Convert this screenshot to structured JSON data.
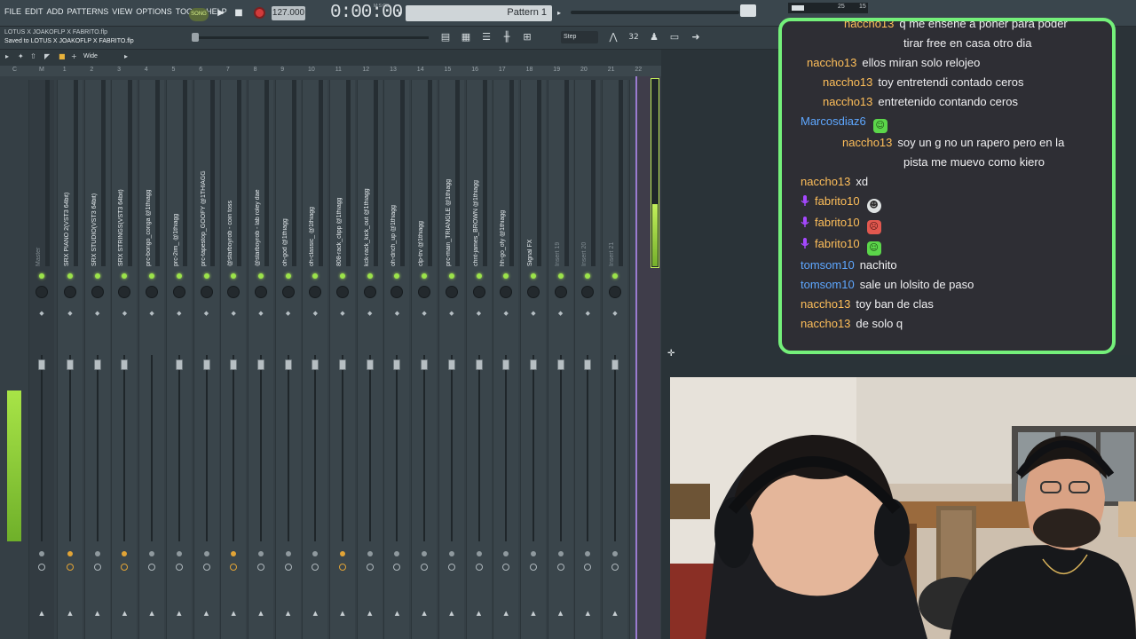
{
  "menubar": {
    "items": [
      "FILE",
      "EDIT",
      "ADD",
      "PATTERNS",
      "VIEW",
      "OPTIONS",
      "TOOLS",
      "HELP"
    ],
    "song_toggle": "SONG",
    "tempo": "127.000",
    "time": "0:00:00",
    "time_unit": "M:S:CS",
    "pattern": "Pattern 1",
    "meter_values": [
      "25",
      "15"
    ]
  },
  "hintbar": {
    "file_line": "LOTUS X JOAKOFLP X FABRITO.flp",
    "status_line": "Saved to LOTUS X JOAKOFLP X FABRITO.flp",
    "snap": "Step"
  },
  "mixer": {
    "view_mode": "Wide",
    "ruler": [
      "C",
      "M",
      "1",
      "2",
      "3",
      "4",
      "5",
      "6",
      "7",
      "8",
      "9",
      "10",
      "11",
      "12",
      "13",
      "14",
      "15",
      "16",
      "17",
      "18",
      "19",
      "20",
      "21",
      "22"
    ],
    "tracks": [
      {
        "name": "Master",
        "dim": true
      },
      {
        "name": "SRX PIANO 2(VST3 64bit)",
        "dim": false
      },
      {
        "name": "SRX STUDIO(VST3 64bit)",
        "dim": false
      },
      {
        "name": "SRX STRINGS(VST3 64bit)",
        "dim": false
      },
      {
        "name": "prc-bongo_conga @1thiagg",
        "dim": false
      },
      {
        "name": "prc-2im_ @1thiagg",
        "dim": false
      },
      {
        "name": "prc-tapestop_GOOFY @1THIAGG",
        "dim": false
      },
      {
        "name": "@starboyrob - coin toss",
        "dim": false
      },
      {
        "name": "@starboyrob - lab roley dae",
        "dim": false
      },
      {
        "name": "oh-god @1thiagg",
        "dim": false
      },
      {
        "name": "oh-classic_ @1thiagg",
        "dim": false
      },
      {
        "name": "808-rack_clipp @1thiagg",
        "dim": false
      },
      {
        "name": "kck-rack_kick_out @1thiagg",
        "dim": false
      },
      {
        "name": "oh-dnch_up @1thiagg",
        "dim": false
      },
      {
        "name": "clp-trv @1thiagg",
        "dim": false
      },
      {
        "name": "prc-main_TRIANGLE @1thiagg",
        "dim": false
      },
      {
        "name": "chnt-james_BROWN @1thiagg",
        "dim": false
      },
      {
        "name": "hh-go_ofy @1thiagg",
        "dim": false
      },
      {
        "name": "Signal FX",
        "dim": false
      },
      {
        "name": "Insert 19",
        "dim": true
      },
      {
        "name": "Insert 20",
        "dim": true
      },
      {
        "name": "Insert 21",
        "dim": true
      },
      {
        "name": "Insert 22",
        "dim": false
      }
    ]
  },
  "chat": {
    "messages": [
      {
        "user": "naccho13",
        "color": "#ffbf5a",
        "text": "q me enseñe a poner para poder",
        "mic": false,
        "emote": null
      },
      {
        "user": "",
        "color": "#ffbf5a",
        "text": "tirar free en casa otro dia",
        "mic": false,
        "emote": null
      },
      {
        "user": "naccho13",
        "color": "#ffbf5a",
        "text": "ellos miran solo relojeo",
        "mic": false,
        "emote": null
      },
      {
        "user": "naccho13",
        "color": "#ffbf5a",
        "text": "toy entretendi contado ceros",
        "mic": false,
        "emote": null
      },
      {
        "user": "naccho13",
        "color": "#ffbf5a",
        "text": "entretenido contando ceros",
        "mic": false,
        "emote": null
      },
      {
        "user": "Marcosdiaz6",
        "color": "#5ea7ff",
        "text": "",
        "mic": false,
        "emote": "green"
      },
      {
        "user": "naccho13",
        "color": "#ffbf5a",
        "text": "soy un g no un rapero pero en la",
        "mic": false,
        "emote": null
      },
      {
        "user": "",
        "color": "#ffbf5a",
        "text": "pista me muevo como kiero",
        "mic": false,
        "emote": null
      },
      {
        "user": "naccho13",
        "color": "#ffbf5a",
        "text": "xd",
        "mic": false,
        "emote": null
      },
      {
        "user": "fabrito10",
        "color": "#ffbf5a",
        "text": "",
        "mic": true,
        "emote": "white"
      },
      {
        "user": "fabrito10",
        "color": "#ffbf5a",
        "text": "",
        "mic": true,
        "emote": "red"
      },
      {
        "user": "fabrito10",
        "color": "#ffbf5a",
        "text": "",
        "mic": true,
        "emote": "green"
      },
      {
        "user": "tomsom10",
        "color": "#5ea7ff",
        "text": "nachito",
        "mic": false,
        "emote": null
      },
      {
        "user": "tomsom10",
        "color": "#5ea7ff",
        "text": "sale un lolsito de paso",
        "mic": false,
        "emote": null
      },
      {
        "user": "naccho13",
        "color": "#ffbf5a",
        "text": "toy ban de clas",
        "mic": false,
        "emote": null
      },
      {
        "user": "naccho13",
        "color": "#ffbf5a",
        "text": "de solo q",
        "mic": false,
        "emote": null
      }
    ]
  },
  "colors": {
    "chat_border": "#74f07a",
    "meter_green": "#a8e447",
    "accent_purple": "#9a7bd0"
  }
}
